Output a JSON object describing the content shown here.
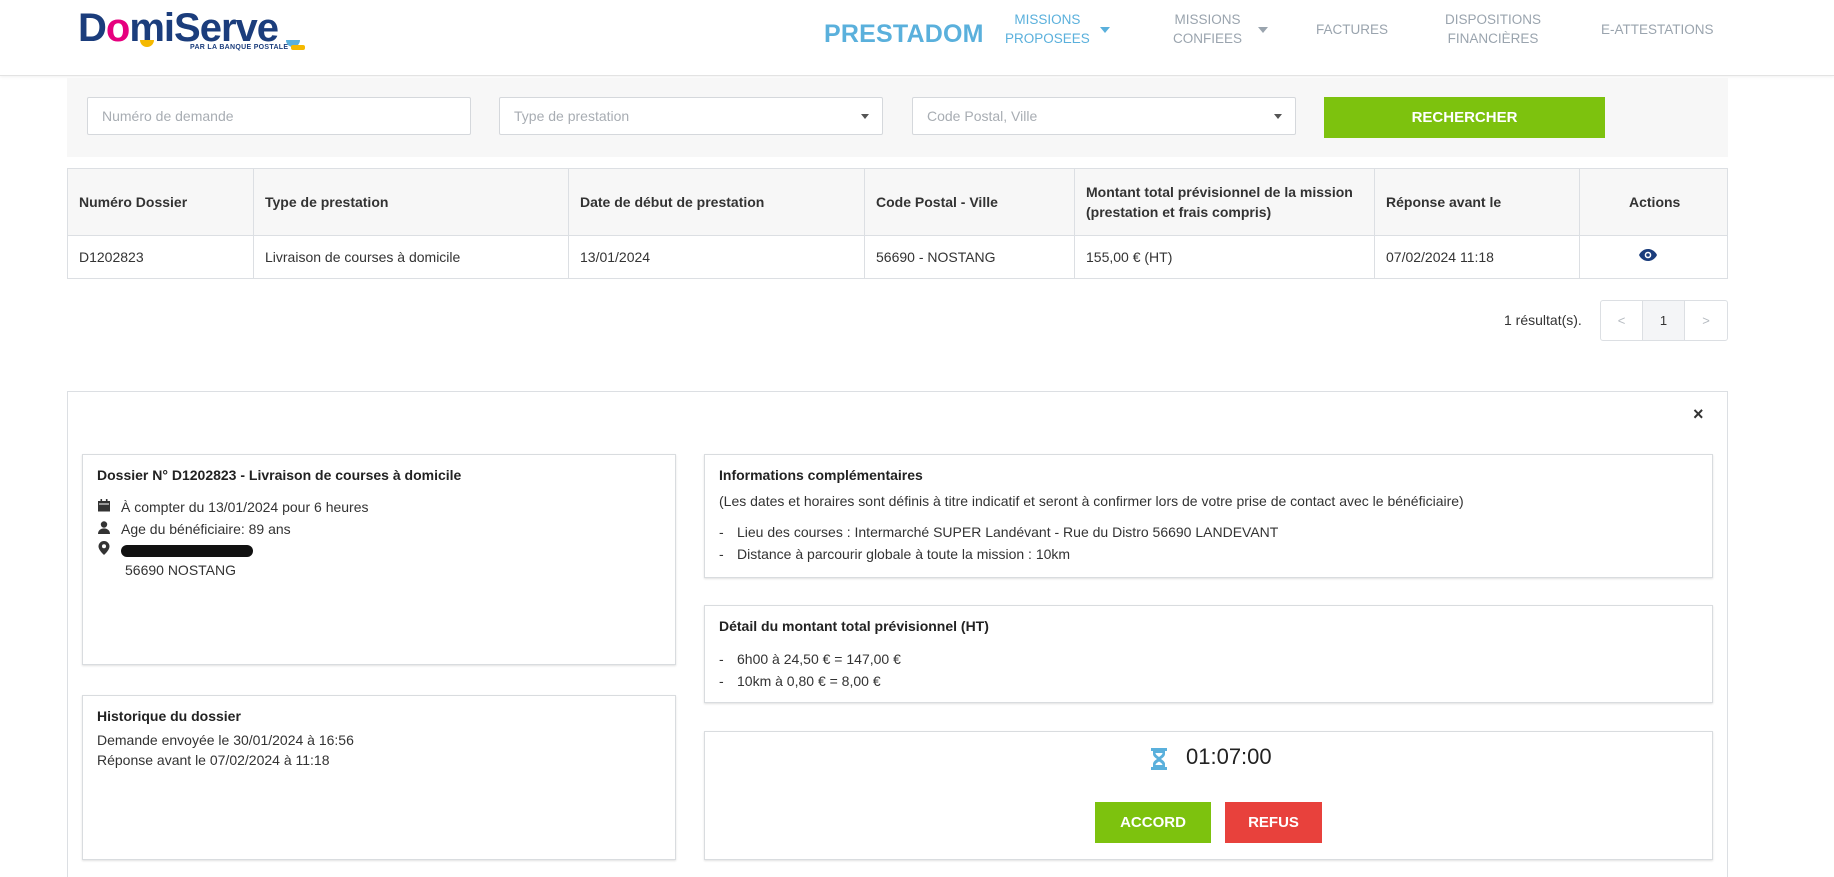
{
  "header": {
    "logo": {
      "text_d": "D",
      "text_o": "o",
      "text_rest": "mi",
      "text_s": "Serve",
      "subtitle": "PAR LA BANQUE POSTALE"
    },
    "brand": "PRESTADOM",
    "nav": [
      {
        "line1": "MISSIONS",
        "line2": "PROPOSEES"
      },
      {
        "line1": "MISSIONS",
        "line2": "CONFIEES"
      },
      {
        "line1": "FACTURES",
        "line2": ""
      },
      {
        "line1": "DISPOSITIONS",
        "line2": "FINANCIÈRES"
      },
      {
        "line1": "E-ATTESTATIONS",
        "line2": ""
      }
    ]
  },
  "search": {
    "numero_placeholder": "Numéro de demande",
    "type_placeholder": "Type de prestation",
    "code_placeholder": "Code Postal, Ville",
    "button": "RECHERCHER"
  },
  "table": {
    "headers": [
      "Numéro Dossier",
      "Type de prestation",
      "Date de début de prestation",
      "Code Postal - Ville",
      "Montant total prévisionnel de la mission",
      "(prestation et frais compris)",
      "Réponse avant le",
      "Actions"
    ],
    "rows": [
      {
        "numero": "D1202823",
        "type": "Livraison de courses à domicile",
        "date": "13/01/2024",
        "ville": "56690 - NOSTANG",
        "montant": "155,00 € (HT)",
        "reponse": "07/02/2024 11:18",
        "action_icon": "eye-icon"
      }
    ]
  },
  "pagination": {
    "results": "1 résultat(s).",
    "prev": "<",
    "page": "1",
    "next": ">"
  },
  "detail": {
    "close": "×",
    "dossier": {
      "title": "Dossier N° D1202823 - Livraison de courses à domicile",
      "date_line": "À compter du 13/01/2024 pour 6 heures",
      "age_line": "Age du bénéficiaire: 89 ans",
      "ville_line": "56690 NOSTANG"
    },
    "historique": {
      "title": "Historique du dossier",
      "line1": "Demande envoyée le 30/01/2024 à 16:56",
      "line2": "Réponse avant le 07/02/2024 à 11:18"
    },
    "infos": {
      "title": "Informations complémentaires",
      "note": "(Les dates et horaires sont définis à titre indicatif et seront à confirmer lors de votre prise de contact avec le bénéficiaire)",
      "items": [
        "Lieu des courses : Intermarché SUPER Landévant - Rue du Distro 56690 LANDEVANT",
        "Distance à parcourir globale à toute la mission : 10km"
      ]
    },
    "montant": {
      "title": "Détail du montant total prévisionnel (HT)",
      "items": [
        "6h00 à 24,50 € = 147,00 €",
        "10km à 0,80 € = 8,00 €"
      ]
    },
    "timer": "01:07:00",
    "accord": "ACCORD",
    "refus": "REFUS"
  },
  "colors": {
    "green": "#7dc20e",
    "red": "#e8413c",
    "blue": "#5ab0dc",
    "navy": "#1b3d7c"
  }
}
